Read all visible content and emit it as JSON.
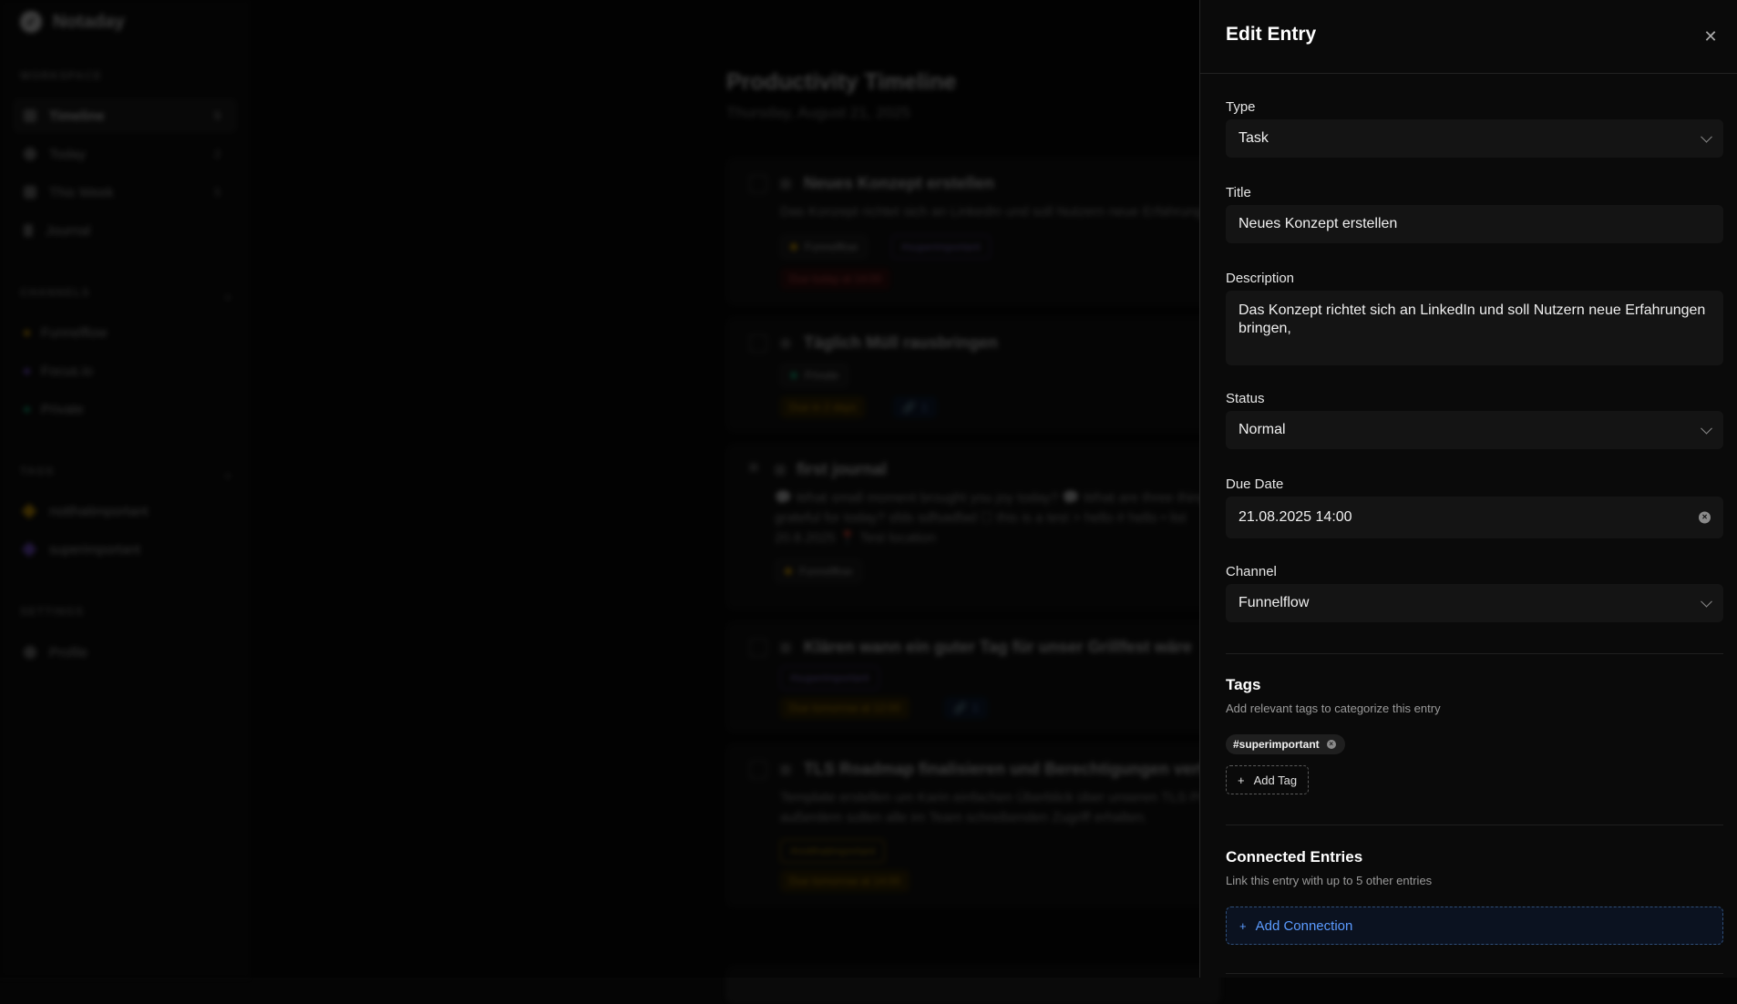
{
  "app": {
    "name": "Notaday"
  },
  "sidebar": {
    "workspace_label": "WORKSPACE",
    "workspace_items": [
      {
        "label": "Timeline",
        "count": "5",
        "icon": "list-icon"
      },
      {
        "label": "Today",
        "count": "2",
        "icon": "clock-icon"
      },
      {
        "label": "This Week",
        "count": "5",
        "icon": "calendar-icon"
      },
      {
        "label": "Journal",
        "count": "",
        "icon": "book-icon"
      }
    ],
    "channels_label": "CHANNELS",
    "channels": [
      {
        "label": "Funnelflow",
        "color": "#f5b400"
      },
      {
        "label": "Focus.io",
        "color": "#8b5cf6"
      },
      {
        "label": "Private",
        "color": "#10b981"
      }
    ],
    "tags_label": "TAGS",
    "tags": [
      {
        "label": "notthatimportant",
        "color": "#f5b400"
      },
      {
        "label": "superimportant",
        "color": "#8b5cf6"
      }
    ],
    "settings_label": "SETTINGS",
    "settings_items": [
      {
        "label": "Profile",
        "icon": "user-icon"
      }
    ]
  },
  "main": {
    "title": "Productivity Timeline",
    "date": "Thursday, August 21, 2025",
    "cards": [
      {
        "title": "Neues Konzept erstellen",
        "desc": "Das Konzept richtet sich an LinkedIn und soll Nutzern neue Erfahrungen bringen,",
        "channel": "Funnelflow",
        "tag": "#superimportant",
        "due": "Due today at 14:00"
      },
      {
        "title": "Täglich Müll rausbringen",
        "channel": "Private",
        "due": "Due in 2 days",
        "links": "1"
      },
      {
        "title": "first journal",
        "desc1": "💬 What small moment brought you joy today? 💬 What are three things you are",
        "desc2": "grateful for today? sfds sdfsadfad ☐ this is a test > hello # hello • list",
        "desc3": "20.8.2025  📍 Test location",
        "channel": "Funnelflow"
      },
      {
        "title": "Klären wann ein guter Tag für unser Grillfest wäre",
        "tag": "#superimportant",
        "due": "Due tomorrow at 12:00",
        "links": "1"
      },
      {
        "title": "TLS Roadmap finalisieren und Berechtigungen verteilen",
        "desc1": "Template erstellen um Karin einfachen Überblick über unseren TLS Prozess zu geben,",
        "desc2": "außerdem sollen alle im Team schreibenden Zugriff erhalten.",
        "tag": "#notthatimportant",
        "due": "Due tomorrow at 14:00"
      }
    ]
  },
  "panel": {
    "title": "Edit Entry",
    "type_label": "Type",
    "type_value": "Task",
    "title_label": "Title",
    "title_value": "Neues Konzept erstellen",
    "description_label": "Description",
    "description_value": "Das Konzept richtet sich an LinkedIn und soll Nutzern neue Erfahrungen bringen,",
    "status_label": "Status",
    "status_value": "Normal",
    "due_label": "Due Date",
    "due_value": "21.08.2025 14:00",
    "channel_label": "Channel",
    "channel_value": "Funnelflow",
    "tags_title": "Tags",
    "tags_sub": "Add relevant tags to categorize this entry",
    "tag_chip": "#superimportant",
    "add_tag": "Add Tag",
    "connected_title": "Connected Entries",
    "connected_sub": "Link this entry with up to 5 other entries",
    "add_connection": "Add Connection"
  }
}
